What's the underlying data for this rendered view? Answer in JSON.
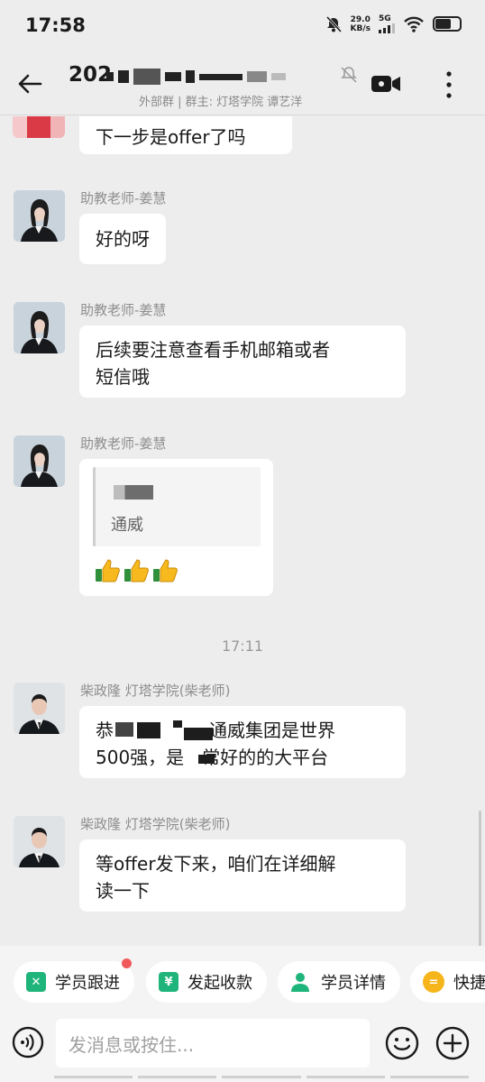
{
  "status": {
    "time": "17:58",
    "speed_value": "29.0",
    "speed_unit": "KB/s",
    "network": "5G",
    "icons": [
      "mute-bell-icon",
      "signal-icon",
      "wifi-icon",
      "battery-icon"
    ]
  },
  "header": {
    "title_prefix": "202",
    "subtitle": "外部群 | 群主: 灯塔学院 谭艺洋",
    "icons": [
      "back-arrow-icon",
      "mute-icon",
      "video-call-icon",
      "more-vertical-icon"
    ]
  },
  "messages": [
    {
      "sender": "",
      "text": "下一步是offer了吗"
    },
    {
      "sender": "助教老师-姜慧",
      "text": "好的呀"
    },
    {
      "sender": "助教老师-姜慧",
      "lines": [
        "后续要注意查看手机邮箱或者",
        "短信哦"
      ]
    },
    {
      "sender": "助教老师-姜慧",
      "quote_text": "通威",
      "emoji": "thumbs-up",
      "emoji_count": 3
    },
    {
      "sender": "柴政隆 灯塔学院(柴老师)",
      "line1_a": "恭",
      "line1_b": "通威集团是世界",
      "line2_a": "500强，是",
      "line2_b": "常好的的大平台"
    },
    {
      "sender": "柴政隆 灯塔学院(柴老师)",
      "lines": [
        "等offer发下来，咱们在详细解",
        "读一下"
      ]
    }
  ],
  "timestamp": "17:11",
  "quick_actions": [
    {
      "label": "学员跟进",
      "icon": "follow-up-icon",
      "color": "#1fb57a",
      "badge": true
    },
    {
      "label": "发起收款",
      "icon": "yen-icon",
      "color": "#1fb57a",
      "badge": false
    },
    {
      "label": "学员详情",
      "icon": "user-icon",
      "color": "#1fb57a",
      "badge": false
    },
    {
      "label": "快捷",
      "icon": "quick-reply-icon",
      "color": "#f6b51a",
      "badge": false
    }
  ],
  "input": {
    "placeholder": "发消息或按住..."
  }
}
